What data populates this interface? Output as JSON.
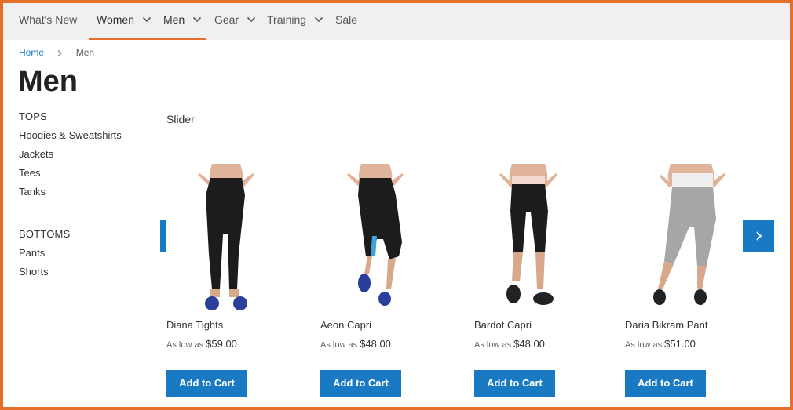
{
  "nav": {
    "items": [
      {
        "label": "What's New",
        "has_dropdown": false,
        "active": false
      },
      {
        "label": "Women",
        "has_dropdown": true,
        "active": true
      },
      {
        "label": "Men",
        "has_dropdown": true,
        "active": true
      },
      {
        "label": "Gear",
        "has_dropdown": true,
        "active": false
      },
      {
        "label": "Training",
        "has_dropdown": true,
        "active": false
      },
      {
        "label": "Sale",
        "has_dropdown": false,
        "active": false
      }
    ]
  },
  "breadcrumb": {
    "home": "Home",
    "current": "Men"
  },
  "page": {
    "title": "Men"
  },
  "sidebar": {
    "groups": [
      {
        "heading": "TOPS",
        "links": [
          "Hoodies & Sweatshirts",
          "Jackets",
          "Tees",
          "Tanks"
        ]
      },
      {
        "heading": "BOTTOMS",
        "links": [
          "Pants",
          "Shorts"
        ]
      }
    ]
  },
  "slider": {
    "title": "Slider",
    "prev_icon": "chevron-left-icon",
    "next_icon": "chevron-right-icon",
    "products": [
      {
        "name": "Diana Tights",
        "price_prefix": "As low as",
        "price": "$59.00",
        "button": "Add to Cart"
      },
      {
        "name": "Aeon Capri",
        "price_prefix": "As low as",
        "price": "$48.00",
        "button": "Add to Cart"
      },
      {
        "name": "Bardot Capri",
        "price_prefix": "As low as",
        "price": "$48.00",
        "button": "Add to Cart"
      },
      {
        "name": "Daria Bikram Pant",
        "price_prefix": "As low as",
        "price": "$51.00",
        "button": "Add to Cart"
      }
    ]
  },
  "colors": {
    "accent": "#e46f2b",
    "primary_button": "#1979c3",
    "nav_bg": "#f0f0f0"
  }
}
